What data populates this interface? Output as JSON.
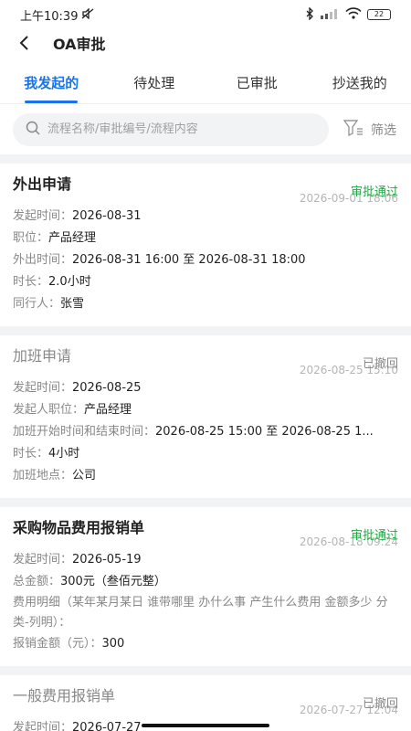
{
  "status_bar": {
    "time": "上午10:39",
    "battery": "22"
  },
  "nav": {
    "title": "OA审批"
  },
  "tabs": [
    {
      "label": "我发起的",
      "active": true
    },
    {
      "label": "待处理",
      "active": false
    },
    {
      "label": "已审批",
      "active": false
    },
    {
      "label": "抄送我的",
      "active": false
    }
  ],
  "search": {
    "placeholder": "流程名称/审批编号/流程内容",
    "filter_label": "筛选"
  },
  "cards": [
    {
      "title": "外出申请",
      "status": "审批通过",
      "time": "2026-09-01 18:06",
      "fields": [
        {
          "label": "发起时间：",
          "value": "2026-08-31"
        },
        {
          "label": "职位：",
          "value": "产品经理"
        },
        {
          "label": "外出时间：",
          "value": "2026-08-31 16:00 至 2026-08-31 18:00"
        },
        {
          "label": "时长：",
          "value": "2.0小时"
        },
        {
          "label": "同行人：",
          "value": "张雪"
        }
      ]
    },
    {
      "title": "加班申请",
      "status": "已撤回",
      "time": "2026-08-25 15:10",
      "fields": [
        {
          "label": "发起时间：",
          "value": "2026-08-25"
        },
        {
          "label": "发起人职位：",
          "value": "产品经理"
        },
        {
          "label": "加班开始时间和结束时间：",
          "value": "2026-08-25 15:00 至 2026-08-25 1..."
        },
        {
          "label": "时长：",
          "value": "4小时"
        },
        {
          "label": "加班地点：",
          "value": "公司"
        }
      ]
    },
    {
      "title": "采购物品费用报销单",
      "status": "审批通过",
      "time": "2026-08-18 09:24",
      "fields": [
        {
          "label": "发起时间：",
          "value": "2026-05-19"
        },
        {
          "label": "总金额：",
          "value": "300元（叁佰元整）"
        },
        {
          "label": "费用明细（某年某月某日 谁带哪里 办什么事 产生什么费用 金额多少 分类-列明）：",
          "value": ""
        },
        {
          "label": "报销金额（元）：",
          "value": "300"
        }
      ]
    },
    {
      "title": "一般费用报销单",
      "status": "已撤回",
      "time": "2026-07-27 12:04",
      "fields": [
        {
          "label": "发起时间：",
          "value": "2026-07-27"
        }
      ]
    }
  ]
}
